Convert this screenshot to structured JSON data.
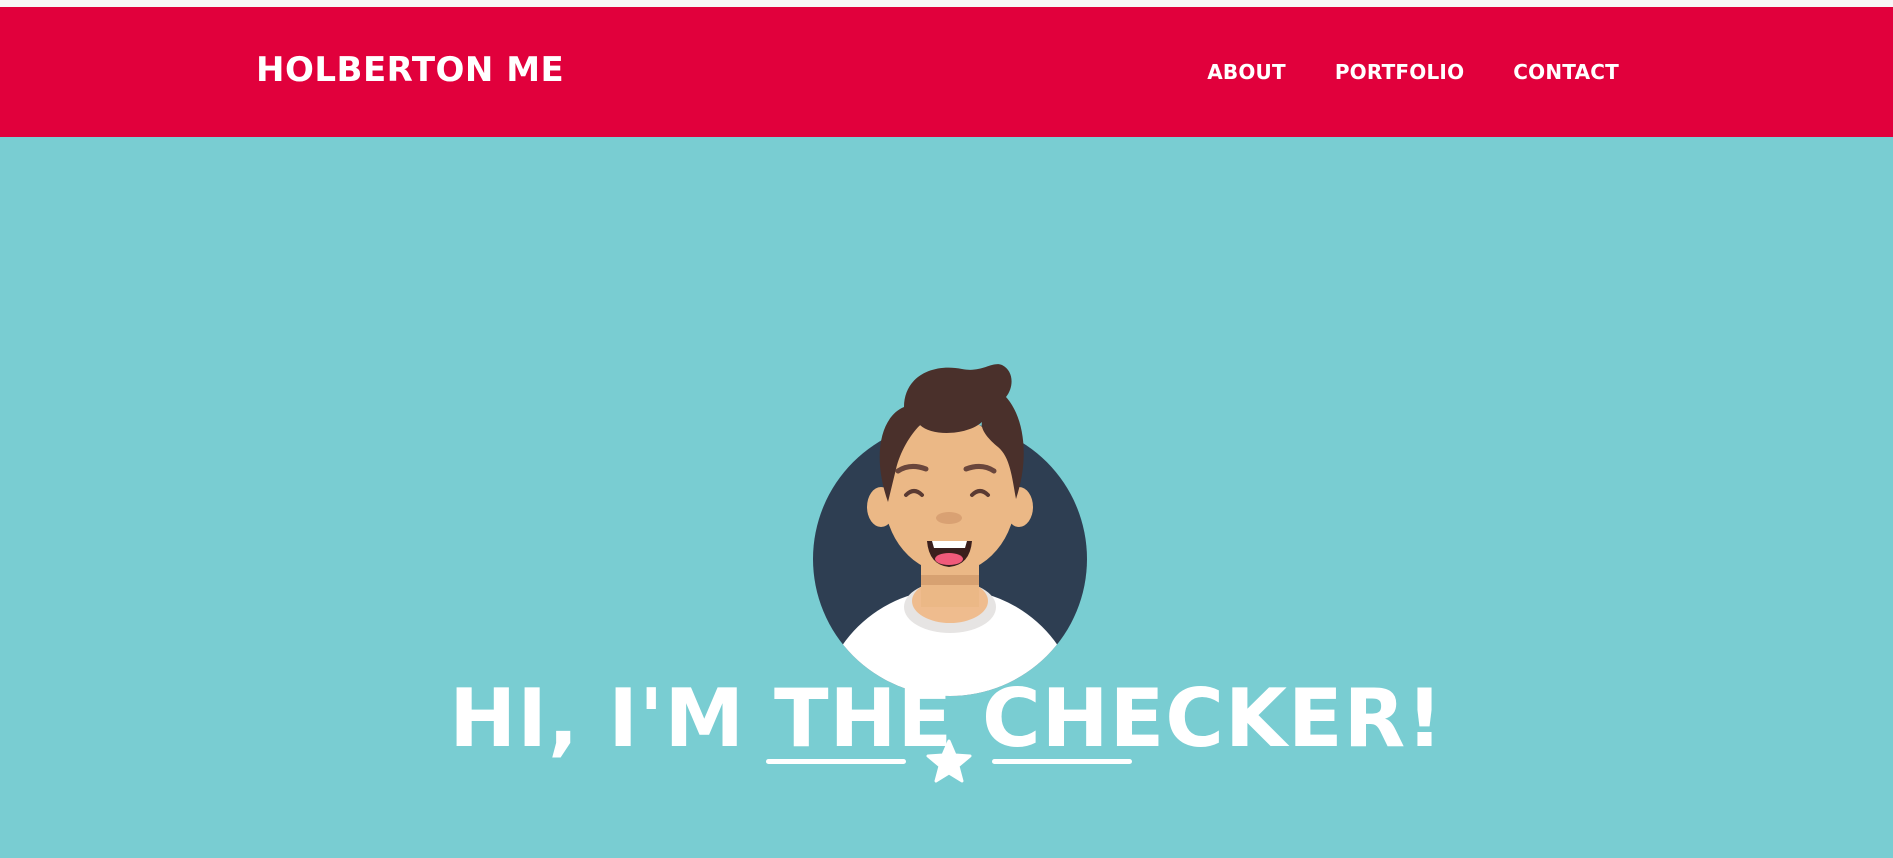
{
  "navbar": {
    "brand": "HOLBERTON ME",
    "background": "#e1003c",
    "links": [
      {
        "label": "ABOUT"
      },
      {
        "label": "PORTFOLIO"
      },
      {
        "label": "CONTACT"
      }
    ]
  },
  "hero": {
    "background": "#79cdd2",
    "title": "HI, I'M THE CHECKER!",
    "avatar_icon": "smiling-person-avatar-icon",
    "divider_icon": "star-icon"
  }
}
